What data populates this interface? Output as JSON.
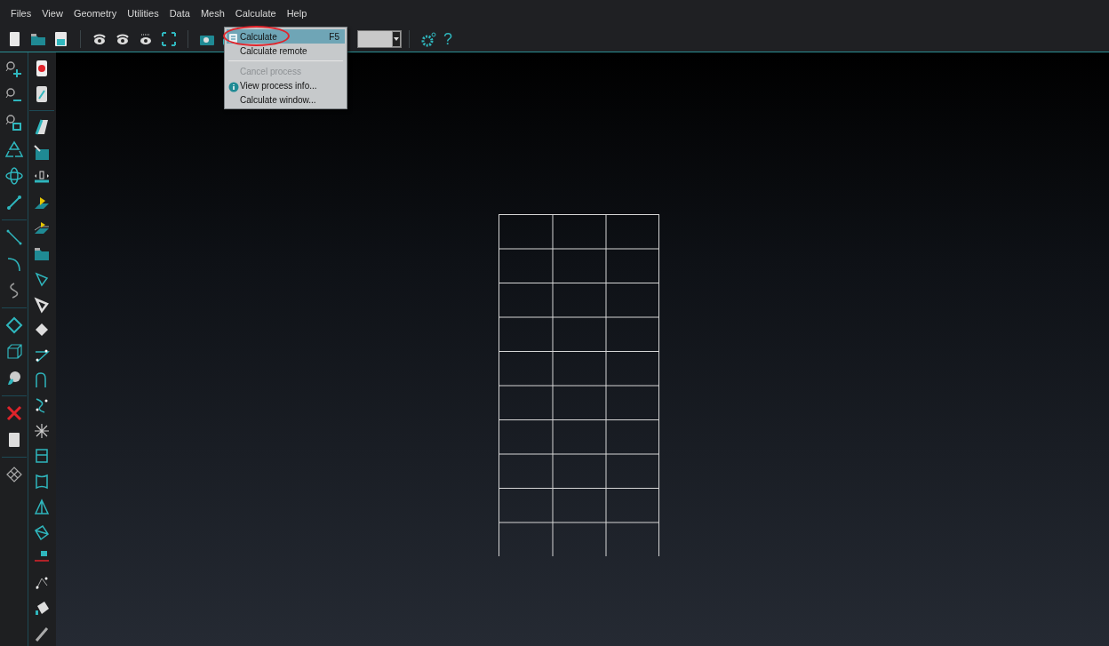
{
  "menu_bar": [
    {
      "label": "Files"
    },
    {
      "label": "View"
    },
    {
      "label": "Geometry"
    },
    {
      "label": "Utilities"
    },
    {
      "label": "Data"
    },
    {
      "label": "Mesh"
    },
    {
      "label": "Calculate"
    },
    {
      "label": "Help"
    }
  ],
  "open_menu": {
    "items": [
      {
        "kind": "command",
        "label": "Calculate",
        "shortcut": "F5",
        "selected": true,
        "disabled": false
      },
      {
        "kind": "command",
        "label": "Calculate remote",
        "selected": false,
        "disabled": false
      },
      {
        "kind": "separator"
      },
      {
        "kind": "command",
        "label": "Cancel process",
        "selected": false,
        "disabled": true
      },
      {
        "kind": "command",
        "label": "View process info...",
        "selected": false,
        "disabled": false
      },
      {
        "kind": "command",
        "label": "Calculate window...",
        "selected": false,
        "disabled": false
      }
    ]
  },
  "toolbar": {
    "help_label": "?"
  }
}
